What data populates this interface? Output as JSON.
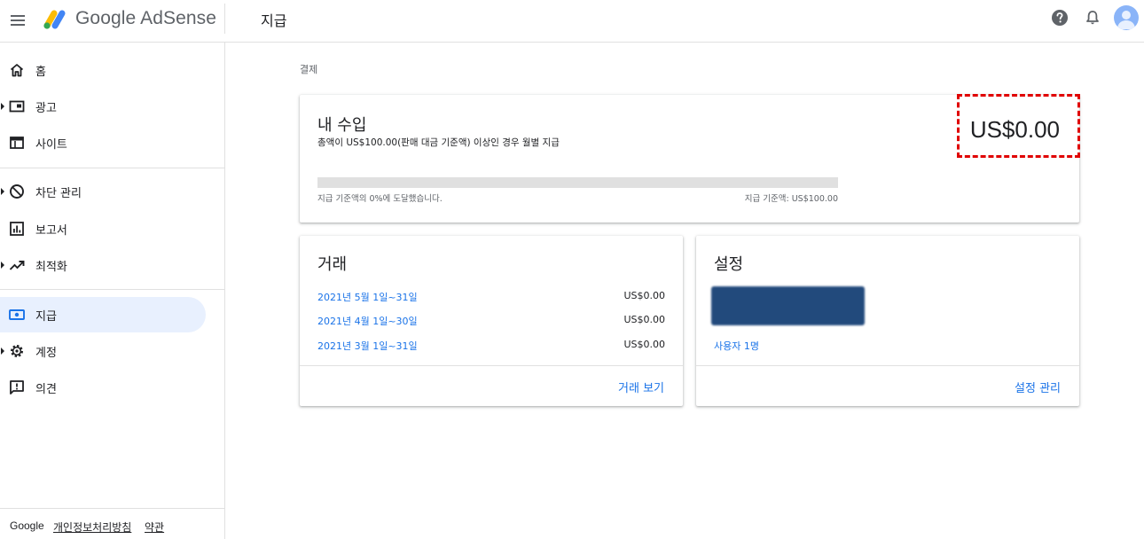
{
  "header": {
    "brand": "Google AdSense",
    "page_title": "지급"
  },
  "sidebar": {
    "items": [
      {
        "label": "홈",
        "icon": "home-icon",
        "arrow": false,
        "active": false
      },
      {
        "label": "광고",
        "icon": "ads-icon",
        "arrow": true,
        "active": false
      },
      {
        "label": "사이트",
        "icon": "sites-icon",
        "arrow": false,
        "active": false
      },
      {
        "label": "차단 관리",
        "icon": "block-icon",
        "arrow": true,
        "active": false
      },
      {
        "label": "보고서",
        "icon": "reports-icon",
        "arrow": false,
        "active": false
      },
      {
        "label": "최적화",
        "icon": "trending-up-icon",
        "arrow": true,
        "active": false
      },
      {
        "label": "지급",
        "icon": "payments-icon",
        "arrow": false,
        "active": true
      },
      {
        "label": "계정",
        "icon": "gear-icon",
        "arrow": true,
        "active": false
      },
      {
        "label": "의견",
        "icon": "feedback-icon",
        "arrow": false,
        "active": false
      }
    ],
    "footer": {
      "google": "Google",
      "privacy": "개인정보처리방침",
      "terms": "약관"
    }
  },
  "main": {
    "breadcrumb": "결제",
    "earnings": {
      "title": "내 수입",
      "description": "총액이 US$100.00(판매 대금 기준액) 이상인 경우 월별 지급",
      "progress_percent": 0,
      "progress_left": "지급 기준액의 0%에 도달했습니다.",
      "progress_right": "지급 기준액: US$100.00",
      "amount": "US$0.00"
    },
    "transactions": {
      "title": "거래",
      "rows": [
        {
          "period": "2021년 5월 1일~31일",
          "amount": "US$0.00"
        },
        {
          "period": "2021년 4월 1일~30일",
          "amount": "US$0.00"
        },
        {
          "period": "2021년 3월 1일~31일",
          "amount": "US$0.00"
        }
      ],
      "action": "거래 보기"
    },
    "settings": {
      "title": "설정",
      "users": "사용자 1명",
      "action": "설정 관리"
    }
  },
  "colors": {
    "accent": "#1a73e8",
    "active_bg": "#e8f0fe",
    "highlight": "#e00000",
    "redacted": "#224a7c"
  }
}
